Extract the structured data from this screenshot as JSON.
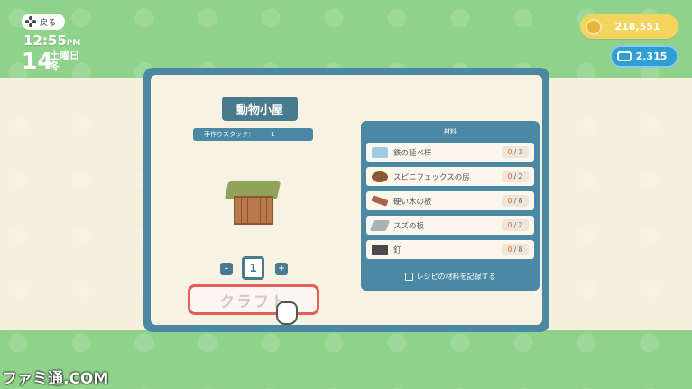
{
  "top_left": {
    "back_label": "戻る",
    "time": "12:55",
    "meridiem": "PM",
    "day_number": "14",
    "weekday": "土曜日",
    "season": "冬"
  },
  "currency": {
    "bells": "218,551",
    "miles": "2,315"
  },
  "recipe": {
    "title": "動物小屋",
    "stack_label": "手作りスタック：",
    "stack_value": "1",
    "quantity": "1",
    "minus_label": "-",
    "plus_label": "+",
    "craft_label": "クラフト"
  },
  "materials": {
    "header": "材料",
    "items": [
      {
        "name": "鉄の延べ棒",
        "have": "0",
        "need": "3",
        "icon": "iron-bar-icon"
      },
      {
        "name": "スピニフェックスの房",
        "have": "0",
        "need": "2",
        "icon": "spinifex-icon"
      },
      {
        "name": "硬い木の板",
        "have": "0",
        "need": "8",
        "icon": "hardwood-plank-icon"
      },
      {
        "name": "スズの板",
        "have": "0",
        "need": "2",
        "icon": "tin-plate-icon"
      },
      {
        "name": "釘",
        "have": "0",
        "need": "8",
        "icon": "nails-icon"
      }
    ],
    "record_label": "レシピの材料を記録する"
  },
  "watermark": "ファミ通.COM"
}
